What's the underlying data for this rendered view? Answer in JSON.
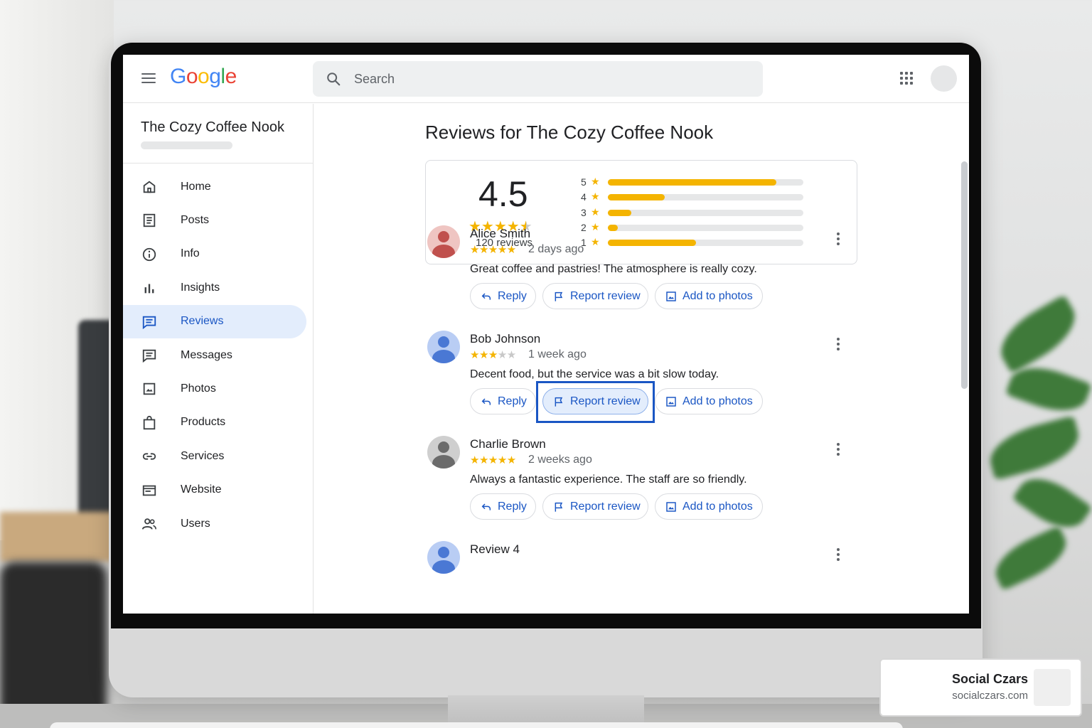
{
  "header": {
    "logo": [
      "G",
      "o",
      "o",
      "g",
      "l",
      "e"
    ],
    "search_placeholder": "Search"
  },
  "sidebar": {
    "business_name": "The Cozy Coffee Nook",
    "items": [
      {
        "label": "Home",
        "icon": "home-icon"
      },
      {
        "label": "Posts",
        "icon": "posts-icon"
      },
      {
        "label": "Info",
        "icon": "info-icon"
      },
      {
        "label": "Insights",
        "icon": "insights-icon"
      },
      {
        "label": "Reviews",
        "icon": "reviews-icon",
        "active": true
      },
      {
        "label": "Messages",
        "icon": "messages-icon"
      },
      {
        "label": "Photos",
        "icon": "photos-icon"
      },
      {
        "label": "Products",
        "icon": "products-icon"
      },
      {
        "label": "Services",
        "icon": "services-icon"
      },
      {
        "label": "Website",
        "icon": "website-icon"
      },
      {
        "label": "Users",
        "icon": "users-icon"
      }
    ]
  },
  "main": {
    "title": "Reviews for The Cozy Coffee Nook",
    "summary": {
      "average": "4.5",
      "average_stars": 4.5,
      "review_count": "120 reviews",
      "distribution": [
        {
          "stars": "5",
          "fraction": 0.86
        },
        {
          "stars": "4",
          "fraction": 0.29
        },
        {
          "stars": "3",
          "fraction": 0.12
        },
        {
          "stars": "2",
          "fraction": 0.05
        },
        {
          "stars": "1",
          "fraction": 0.45
        }
      ]
    },
    "actions": {
      "reply": "Reply",
      "report": "Report review",
      "add_photos": "Add to photos"
    },
    "reviews": [
      {
        "name": "Alice Smith",
        "rating": 5,
        "time": "2 days ago",
        "text": "Great coffee and pastries! The atmosphere is really cozy.",
        "avatar_color": "#c0504d",
        "avatar_bg": "#efc5c2"
      },
      {
        "name": "Bob Johnson",
        "rating": 3,
        "time": "1 week ago",
        "text": "Decent food, but the service was a bit slow today.",
        "avatar_color": "#4a78d4",
        "avatar_bg": "#b9cdf4",
        "report_selected": true
      },
      {
        "name": "Charlie Brown",
        "rating": 5,
        "time": "2 weeks ago",
        "text": "Always a fantastic experience. The staff are so friendly.",
        "avatar_color": "#6b6b6b",
        "avatar_bg": "#cfcfcf"
      },
      {
        "name": "Review 4",
        "rating": 0,
        "time": "",
        "text": "",
        "avatar_color": "#4a78d4",
        "avatar_bg": "#b9cdf4"
      }
    ]
  },
  "watermark": {
    "name": "Social Czars",
    "url": "socialczars.com"
  },
  "colors": {
    "accent": "#1a56c4",
    "star": "#f4b400",
    "active_nav_bg": "#e3edfc"
  }
}
